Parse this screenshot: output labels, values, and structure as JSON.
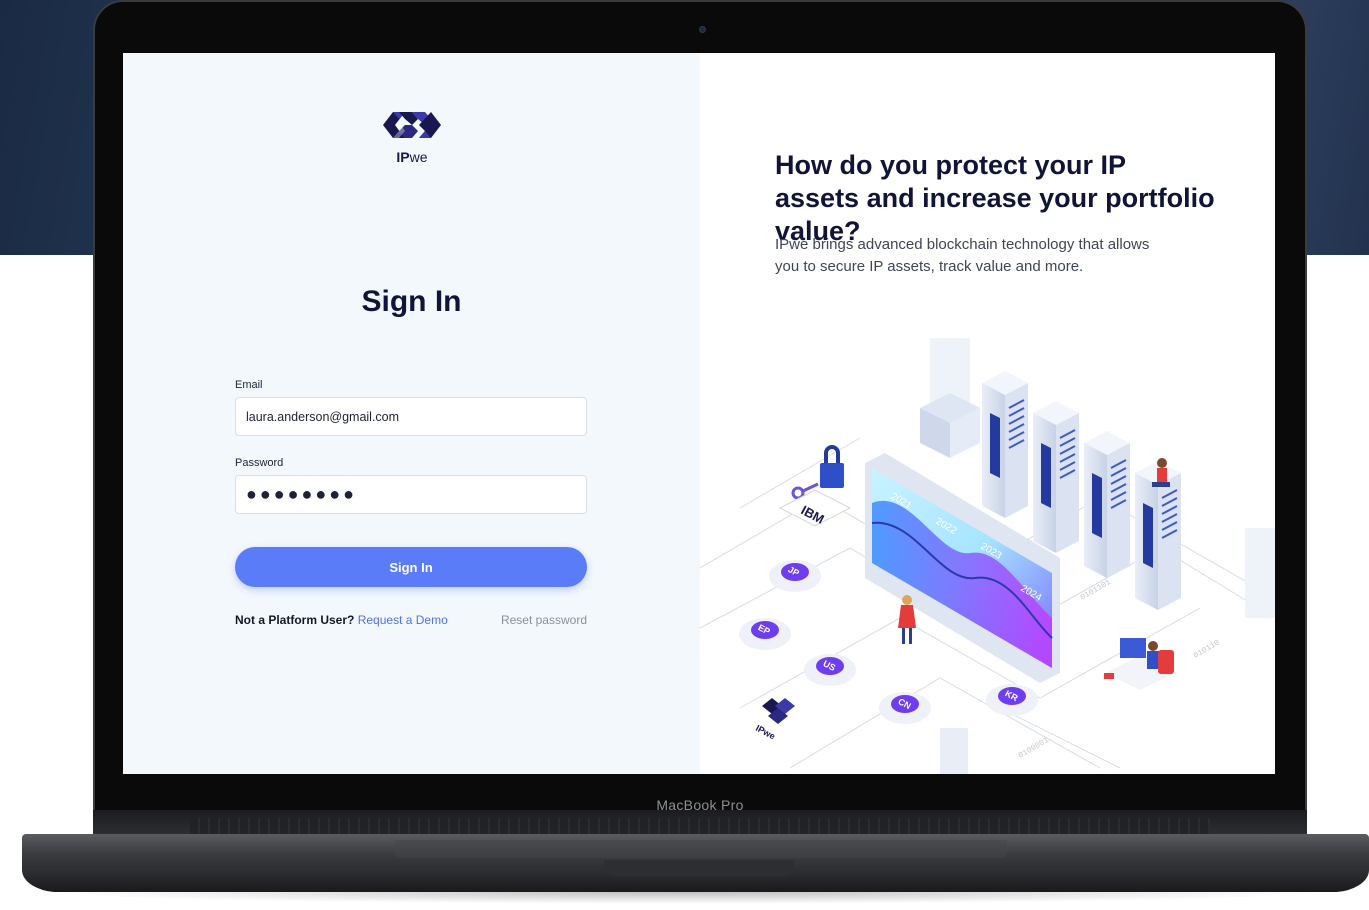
{
  "device": {
    "model_label": "MacBook Pro"
  },
  "left": {
    "logo": {
      "brand_bold": "IP",
      "brand_regular": "we"
    },
    "title": "Sign In",
    "email": {
      "label": "Email",
      "value": "laura.anderson@gmail.com"
    },
    "password": {
      "label": "Password",
      "value": "●●●●●●●●"
    },
    "submit_label": "Sign In",
    "footer": {
      "prompt": "Not a Platform User?",
      "demo_link": "Request a Demo",
      "reset_link": "Reset password"
    }
  },
  "right": {
    "headline": "How do you protect your IP assets and increase your portfolio value?",
    "subtext": "IPwe brings advanced blockchain technology that allows you to secure IP assets, track value and  more.",
    "illustration": {
      "years": [
        "2021",
        "2022",
        "2023",
        "2024"
      ],
      "badges": [
        "JP",
        "EP",
        "US",
        "CN",
        "KR"
      ],
      "brand_tag": "IBM",
      "logo_tag": "IPwe",
      "binary_labels": [
        "0101101",
        "010110",
        "0100001"
      ]
    }
  },
  "colors": {
    "accent": "#5b7cf8",
    "heading": "#101538",
    "link": "#4f72e6",
    "left_bg": "#f3f8fd"
  }
}
